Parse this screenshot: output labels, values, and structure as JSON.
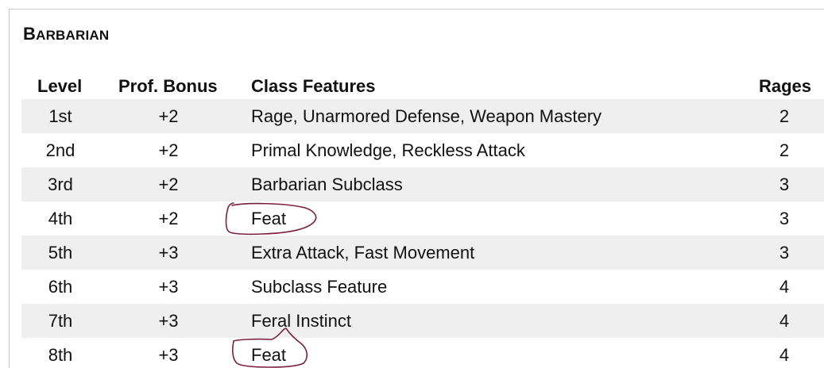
{
  "table": {
    "title_first": "B",
    "title_rest": "ARBARIAN",
    "headers": {
      "level": "Level",
      "prof": "Prof. Bonus",
      "features": "Class Features",
      "rages": "Rages"
    },
    "rows": [
      {
        "level": "1st",
        "prof": "+2",
        "features": "Rage, Unarmored Defense, Weapon Mastery",
        "rages": "2"
      },
      {
        "level": "2nd",
        "prof": "+2",
        "features": "Primal Knowledge, Reckless Attack",
        "rages": "2"
      },
      {
        "level": "3rd",
        "prof": "+2",
        "features": "Barbarian Subclass",
        "rages": "3"
      },
      {
        "level": "4th",
        "prof": "+2",
        "features": "Feat",
        "rages": "3"
      },
      {
        "level": "5th",
        "prof": "+3",
        "features": "Extra Attack, Fast Movement",
        "rages": "3"
      },
      {
        "level": "6th",
        "prof": "+3",
        "features": "Subclass Feature",
        "rages": "4"
      },
      {
        "level": "7th",
        "prof": "+3",
        "features": "Feral Instinct",
        "rages": "4"
      },
      {
        "level": "8th",
        "prof": "+3",
        "features": "Feat",
        "rages": "4"
      }
    ]
  },
  "annotation_color": "#7a1f3a"
}
